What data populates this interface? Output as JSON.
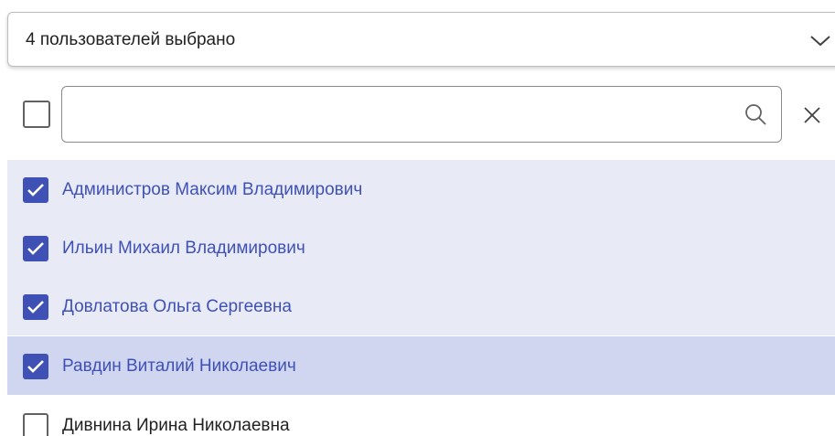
{
  "select": {
    "summary": "4 пользователей выбрано",
    "chevron_icon": "chevron-down-icon"
  },
  "filter": {
    "search_value": "",
    "search_placeholder": "",
    "search_icon": "search-icon",
    "clear_icon": "close-icon",
    "select_all_checked": false
  },
  "users": [
    {
      "name": "Администров Максим Владимирович",
      "checked": true,
      "state": "selected"
    },
    {
      "name": "Ильин Михаил Владимирович",
      "checked": true,
      "state": "selected"
    },
    {
      "name": "Довлатова Ольга Сергеевна",
      "checked": true,
      "state": "selected"
    },
    {
      "name": "Равдин Виталий Николаевич",
      "checked": true,
      "state": "hovered"
    },
    {
      "name": "Дивнина Ирина Николаевна",
      "checked": false,
      "state": "unselected"
    }
  ],
  "colors": {
    "accent": "#3f51b5",
    "selected_bg": "#e8eaf6",
    "hover_bg": "#d0d6ef"
  }
}
